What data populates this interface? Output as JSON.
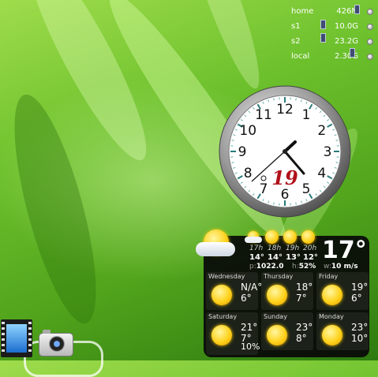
{
  "disk_monitor": {
    "drives": [
      {
        "name": "home",
        "size": "426M"
      },
      {
        "name": "s1",
        "size": "10.0G"
      },
      {
        "name": "s2",
        "size": "23.2G"
      },
      {
        "name": "local",
        "size": "2.30G"
      }
    ]
  },
  "clock": {
    "numerals": [
      "12",
      "1",
      "2",
      "3",
      "4",
      "5",
      "6",
      "7",
      "8",
      "9",
      "10",
      "11"
    ],
    "date": "19",
    "accent": "#b0101a"
  },
  "weather": {
    "current_temp": "17°",
    "hourly": [
      {
        "time": "17h",
        "temp": "14°"
      },
      {
        "time": "18h",
        "temp": "14°"
      },
      {
        "time": "19h",
        "temp": "13°"
      },
      {
        "time": "20h",
        "temp": "12°"
      }
    ],
    "pressure_label": "p:",
    "pressure": "1022.0",
    "humidity_label": "h:",
    "humidity": "52%",
    "wind_label": "w:",
    "wind": "10 m/s",
    "forecast": [
      {
        "day": "Wednesday",
        "high": "N/A°",
        "low": "6°"
      },
      {
        "day": "Thursday",
        "high": "18°",
        "low": "7°"
      },
      {
        "day": "Friday",
        "high": "19°",
        "low": "6°"
      },
      {
        "day": "Saturday",
        "high": "21°",
        "low": "7°",
        "extra": "10%"
      },
      {
        "day": "Sunday",
        "high": "23°",
        "low": "8°"
      },
      {
        "day": "Monday",
        "high": "23°",
        "low": "10°"
      }
    ]
  },
  "dock": {
    "items": [
      {
        "icon": "video-film-icon"
      },
      {
        "icon": "camera-icon"
      }
    ]
  }
}
